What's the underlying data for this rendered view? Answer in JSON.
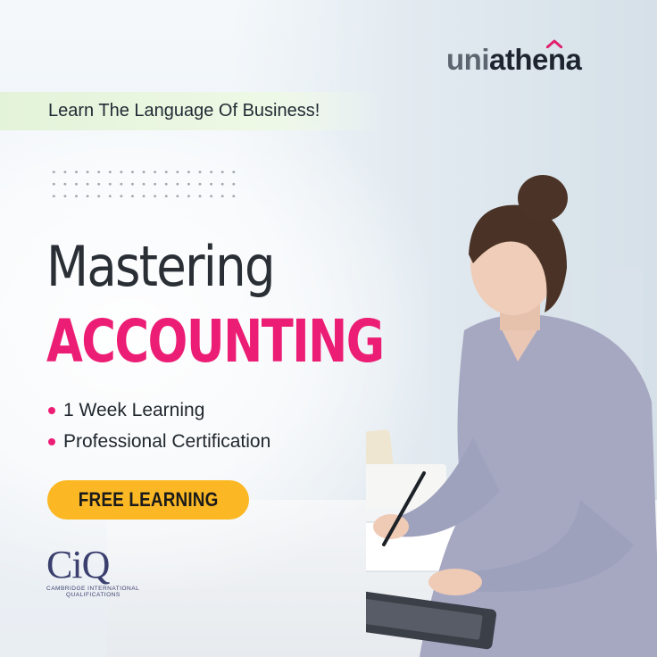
{
  "brand": {
    "logo_prefix": "uni",
    "logo_suffix": "athena"
  },
  "tagline": "Learn The Language Of Business!",
  "headline": {
    "line1": "Mastering",
    "line2": "ACCOUNTING"
  },
  "bullets": [
    "1 Week Learning",
    "Professional Certification"
  ],
  "cta": {
    "label": "FREE LEARNING"
  },
  "partner": {
    "mark": "CiQ",
    "line1": "CAMBRIDGE INTERNATIONAL",
    "line2": "QUALIFICATIONS"
  },
  "colors": {
    "accent_pink": "#ec1d74",
    "cta_yellow": "#fbb824",
    "band_green": "#e3f3d9",
    "logo_dark": "#1e2530"
  }
}
